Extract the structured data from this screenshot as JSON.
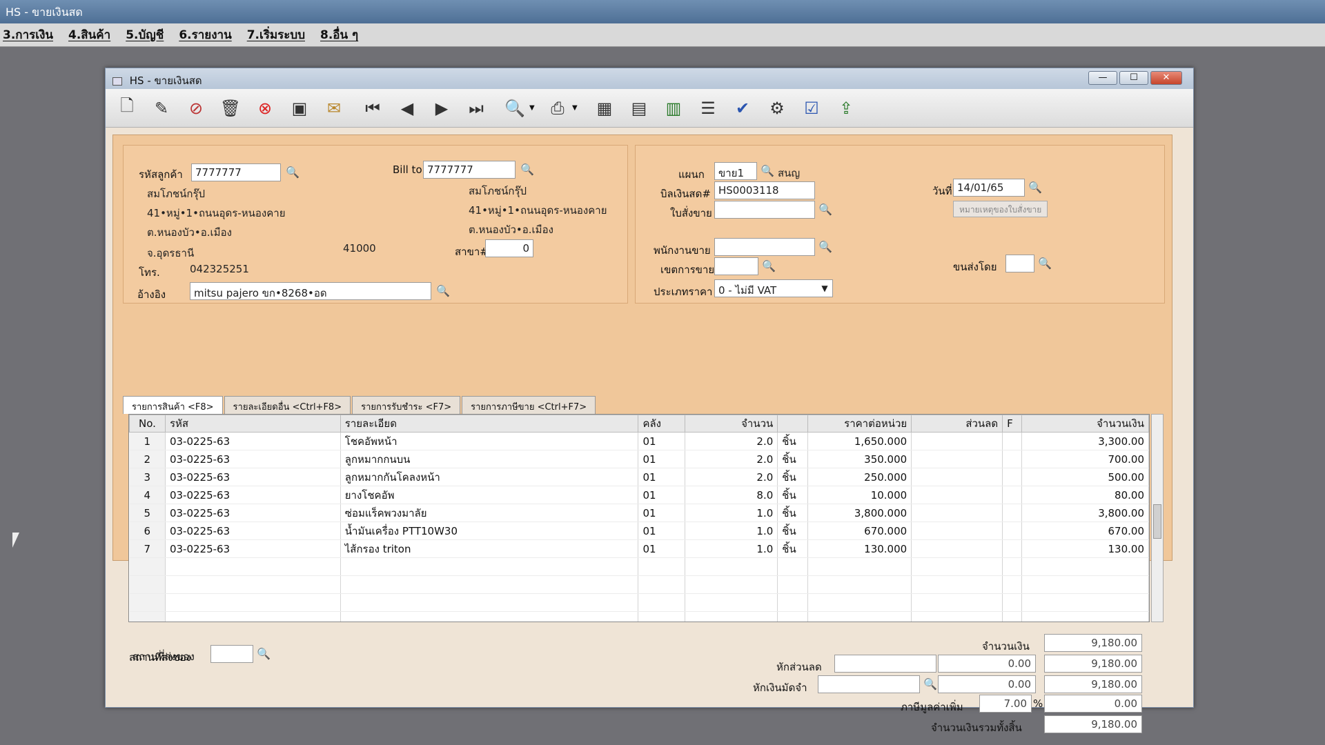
{
  "app": {
    "title": "HS - ขายเงินสด"
  },
  "menu": [
    "3.การเงิน",
    "4.สินค้า",
    "5.บัญชี",
    "6.รายงาน",
    "7.เริ่มระบบ",
    "8.อื่น ๆ"
  ],
  "window": {
    "title": "HS - ขายเงินสด",
    "controls": [
      "minimize-icon",
      "maximize-icon",
      "close-icon"
    ]
  },
  "toolbar": {
    "icons": [
      "new-doc-icon",
      "edit-icon",
      "void-icon",
      "trash-icon",
      "cancel-icon",
      "save-icon",
      "money-icon",
      "first-record-icon",
      "prev-record-icon",
      "next-record-icon",
      "last-record-icon",
      "search-doc-icon",
      "print-icon",
      "calculator-icon",
      "register-icon",
      "cash-drawer-icon",
      "report-icon",
      "approve-icon",
      "tools-icon",
      "ok-icon",
      "export-icon"
    ]
  },
  "customer": {
    "code_label": "รหัสลูกค้า",
    "code": "7777777",
    "name": "สมโภชน์กรุ๊ป",
    "addr1": "41•หมู่•1•ถนนอุดร-หนองคาย",
    "addr2": "ต.หนองบัว•อ.เมือง",
    "province": "จ.อุดรธานี",
    "zip": "41000",
    "phone_label": "โทร.",
    "phone": "042325251",
    "ref_label": "อ้างอิง",
    "ref": "mitsu pajero ขก•8268•อด"
  },
  "billto": {
    "label": "Bill to",
    "code": "7777777",
    "name": "สมโภชน์กรุ๊ป",
    "addr1": "41•หมู่•1•ถนนอุดร-หนองคาย",
    "addr2": "ต.หนองบัว•อ.เมือง",
    "branch_label": "สาขา#",
    "branch": "0"
  },
  "doc": {
    "dept_label": "แผนก",
    "dept": "ขาย1",
    "dept_name": "สนญ",
    "bill_label": "บิลเงินสด#",
    "bill": "HS0003118",
    "order_label": "ใบสั่งขาย",
    "order": "",
    "date_label": "วันที่",
    "date": "14/01/65",
    "note_button": "หมายเหตุของใบสั่งขาย",
    "salesman_label": "พนักงานขาย",
    "salesman": "",
    "area_label": "เขตการขาย",
    "area": "",
    "ship_label": "ขนส่งโดย",
    "ship": "",
    "price_type_label": "ประเภทราคา",
    "price_type": "0 - ไม่มี VAT"
  },
  "tabs": [
    "รายการสินค้า <F8>",
    "รายละเอียดอื่น <Ctrl+F8>",
    "รายการรับชำระ <F7>",
    "รายการภาษีขาย <Ctrl+F7>"
  ],
  "grid": {
    "headers": [
      "No.",
      "รหัส",
      "รายละเอียด",
      "คลัง",
      "จำนวน",
      "",
      "ราคาต่อหน่วย",
      "ส่วนลด",
      "F",
      "จำนวนเงิน"
    ],
    "rows": [
      [
        "1",
        "03-0225-63",
        "โชคอัพหน้า",
        "01",
        "2.0",
        "ชิ้น",
        "1,650.000",
        "",
        "",
        "3,300.00"
      ],
      [
        "2",
        "03-0225-63",
        "ลูกหมากกนบน",
        "01",
        "2.0",
        "ชิ้น",
        "350.000",
        "",
        "",
        "700.00"
      ],
      [
        "3",
        "03-0225-63",
        "ลูกหมากกันโคลงหน้า",
        "01",
        "2.0",
        "ชิ้น",
        "250.000",
        "",
        "",
        "500.00"
      ],
      [
        "4",
        "03-0225-63",
        "ยางโชคอัพ",
        "01",
        "8.0",
        "ชิ้น",
        "10.000",
        "",
        "",
        "80.00"
      ],
      [
        "5",
        "03-0225-63",
        "ซ่อมแร็คพวงมาลัย",
        "01",
        "1.0",
        "ชิ้น",
        "3,800.000",
        "",
        "",
        "3,800.00"
      ],
      [
        "6",
        "03-0225-63",
        "น้ำมันเครื่อง PTT10W30",
        "01",
        "1.0",
        "ชิ้น",
        "670.000",
        "",
        "",
        "670.00"
      ],
      [
        "7",
        "03-0225-63",
        "ไส้กรอง triton",
        "01",
        "1.0",
        "ชิ้น",
        "130.000",
        "",
        "",
        "130.00"
      ]
    ]
  },
  "footer": {
    "delivery_label": "สถานที่ส่งของ",
    "delivery": "",
    "amount_label": "จำนวนเงิน",
    "amount": "9,180.00",
    "discount_label": "หักส่วนลด",
    "discount_text": "",
    "discount_value": "0.00",
    "after_discount": "9,180.00",
    "deposit_label": "หักเงินมัดจำ",
    "deposit_text": "",
    "deposit_value": "0.00",
    "after_deposit": "9,180.00",
    "vat_label": "ภาษีมูลค่าเพิ่ม",
    "vat_rate": "7.00",
    "vat_pct": "%",
    "vat_amount": "0.00",
    "grand_label": "จำนวนเงินรวมทั้งสิ้น",
    "grand_total": "9,180.00"
  }
}
